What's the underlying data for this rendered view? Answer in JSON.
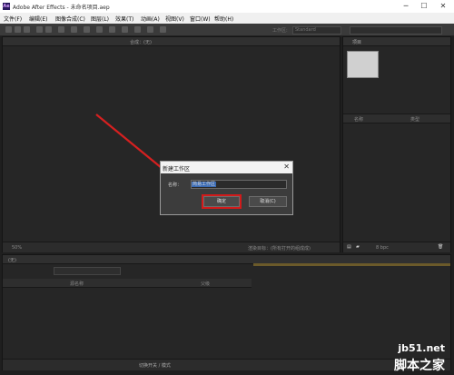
{
  "window": {
    "app_icon": "Ae",
    "title": "Adobe After Effects - 未命名项目.aep",
    "minimize": "─",
    "maximize": "☐",
    "close": "✕"
  },
  "menu": [
    {
      "label": "文件(F)"
    },
    {
      "label": "编辑(E)"
    },
    {
      "label": "图像合成(C)"
    },
    {
      "label": "图层(L)"
    },
    {
      "label": "效果(T)"
    },
    {
      "label": "动画(A)"
    },
    {
      "label": "视图(V)"
    },
    {
      "label": "窗口(W)"
    },
    {
      "label": "帮助(H)"
    }
  ],
  "toolbar": {
    "workspace_label": "工作区:",
    "workspace_value": "Standard"
  },
  "composition_panel": {
    "tab": "合成：(无)",
    "zoom": "50%",
    "status": "渲染目标：(所有打开的组成成)"
  },
  "project_panel": {
    "tab": "项目",
    "col_name": "名称",
    "col_type": "类型",
    "bpc": "8 bpc"
  },
  "timeline": {
    "tab": "(无)",
    "col_source": "源名称",
    "col_parent": "父级",
    "bottom_toggle": "切换开关 / 模式"
  },
  "dialog": {
    "title": "新建工作区",
    "close": "✕",
    "name_label": "名称：",
    "name_value": "简易工作区",
    "ok": "确定",
    "cancel": "取消(C)"
  },
  "watermark": {
    "line1": "jb51.net",
    "line2": "脚本之家"
  }
}
